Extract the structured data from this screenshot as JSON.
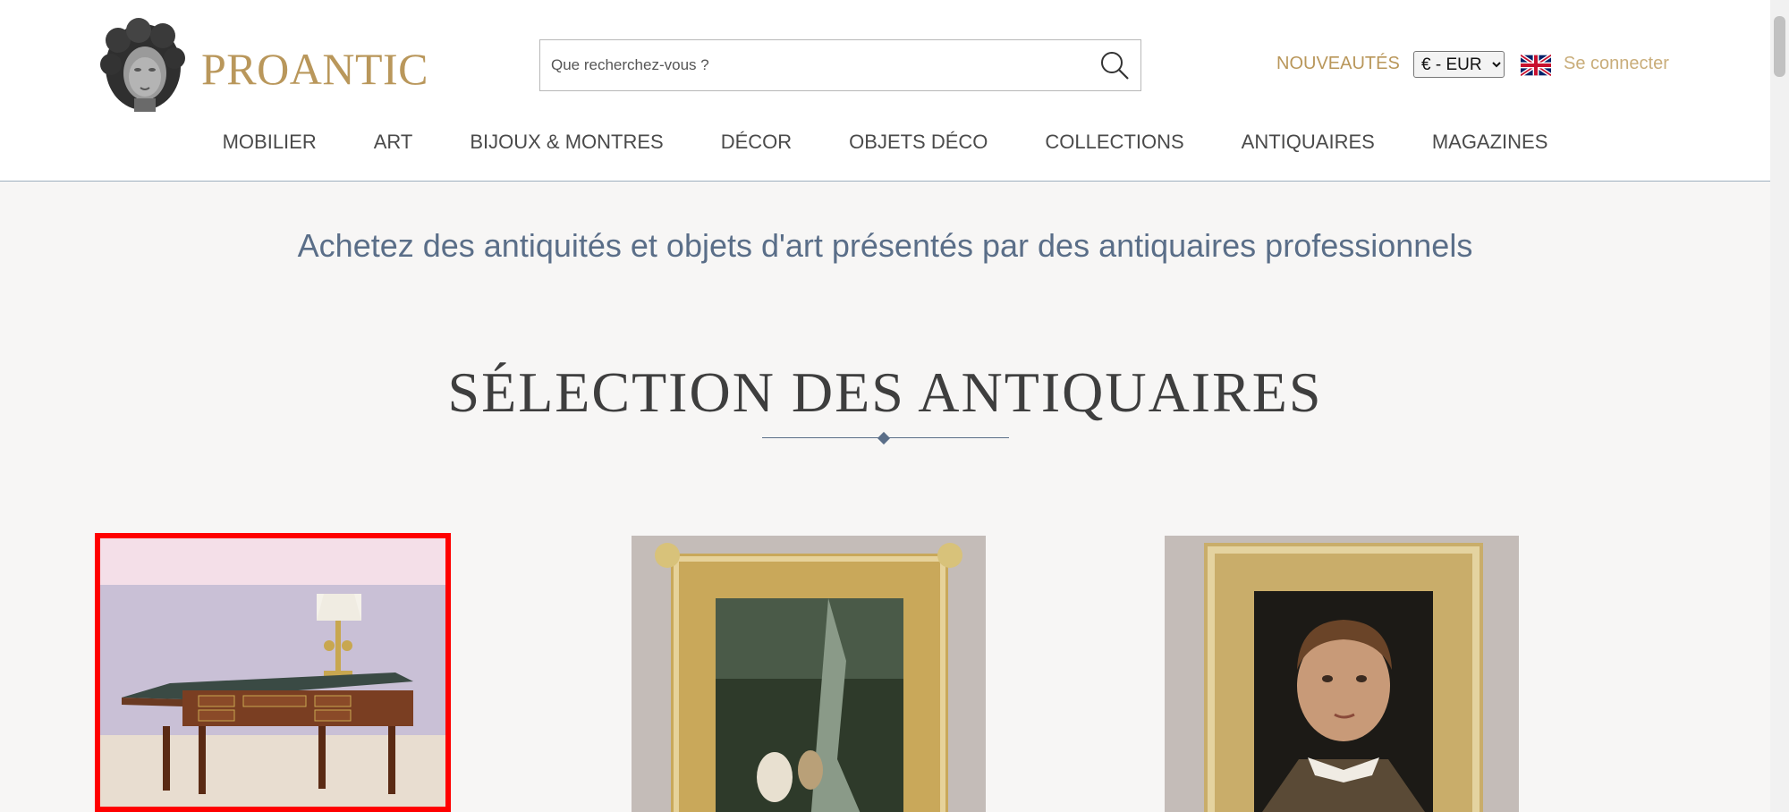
{
  "header": {
    "logo_text": "PROANTIC",
    "search": {
      "placeholder": "Que recherchez-vous ?"
    },
    "nouveautes": "NOUVEAUTÉS",
    "currency": {
      "selected": "€ - EUR"
    },
    "language_flag": "uk-flag-icon",
    "login": "Se connecter"
  },
  "nav": {
    "items": [
      {
        "label": "MOBILIER"
      },
      {
        "label": "ART"
      },
      {
        "label": "BIJOUX & MONTRES"
      },
      {
        "label": "DÉCOR"
      },
      {
        "label": "OBJETS DÉCO"
      },
      {
        "label": "COLLECTIONS"
      },
      {
        "label": "ANTIQUAIRES"
      },
      {
        "label": "MAGAZINES"
      }
    ]
  },
  "main": {
    "tagline": "Achetez des antiquités et objets d'art présentés par des antiquaires professionnels",
    "section_title": "SÉLECTION DES ANTIQUAIRES"
  },
  "colors": {
    "brand_gold": "#b9975b",
    "text_blue": "#5a6e88",
    "highlight_red": "#ff0000",
    "background": "#f7f6f5"
  }
}
